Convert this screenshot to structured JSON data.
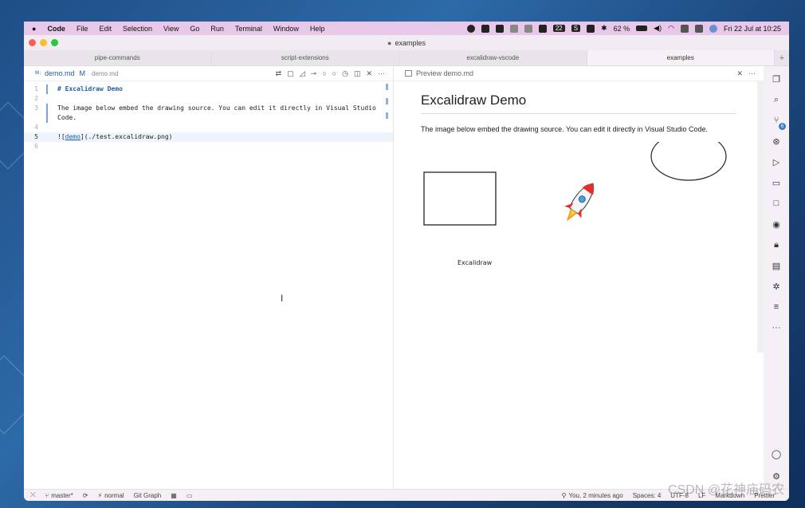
{
  "menubar": {
    "apple": "",
    "app_name": "Code",
    "items": [
      "File",
      "Edit",
      "Selection",
      "View",
      "Go",
      "Run",
      "Terminal",
      "Window",
      "Help"
    ],
    "tray_badge": "22",
    "tray_s": "S",
    "battery": "62 %",
    "datetime": "Fri 22 Jul at 10:25"
  },
  "window": {
    "title": "examples",
    "tabs": [
      "pipe-commands",
      "script-extensions",
      "excalidraw-vscode",
      "examples"
    ],
    "tab_add": "+"
  },
  "editor": {
    "tab": {
      "icon": "M↓",
      "name": "demo.md",
      "modified": "M",
      "path": "demo.md"
    },
    "lines": [
      {
        "num": "1",
        "text": "# Excalidraw Demo"
      },
      {
        "num": "2",
        "text": ""
      },
      {
        "num": "3",
        "text": "The image below embed the drawing source. You can edit it directly in Visual Studio"
      },
      {
        "num": "",
        "text": "Code."
      },
      {
        "num": "4",
        "text": ""
      },
      {
        "num": "5",
        "text_prefix": "![",
        "link": "demo",
        "text_suffix": "](./test.excalidraw.png)"
      },
      {
        "num": "6",
        "text": ""
      }
    ],
    "cursor": "I"
  },
  "preview": {
    "tab_label": "Preview demo.md",
    "heading": "Excalidraw Demo",
    "paragraph": "The image below embed the drawing source. You can edit it directly in Visual Studio Code.",
    "drawing_label": "Excalidraw"
  },
  "statusbar": {
    "branch": "master*",
    "mode": "normal",
    "git_graph": "Git Graph",
    "blame": "You, 2 minutes ago",
    "spaces": "Spaces: 4",
    "encoding": "UTF-8",
    "eol": "LF",
    "language": "Markdown",
    "prettier": "Prettier"
  },
  "activity": {
    "scm_badge": "6",
    "more": "···"
  },
  "watermark": "CSDN @花神庙码农",
  "colors": {
    "accent": "#1f5fa8",
    "menubar": "#e8c8e8",
    "badge": "#3b7bd1"
  }
}
